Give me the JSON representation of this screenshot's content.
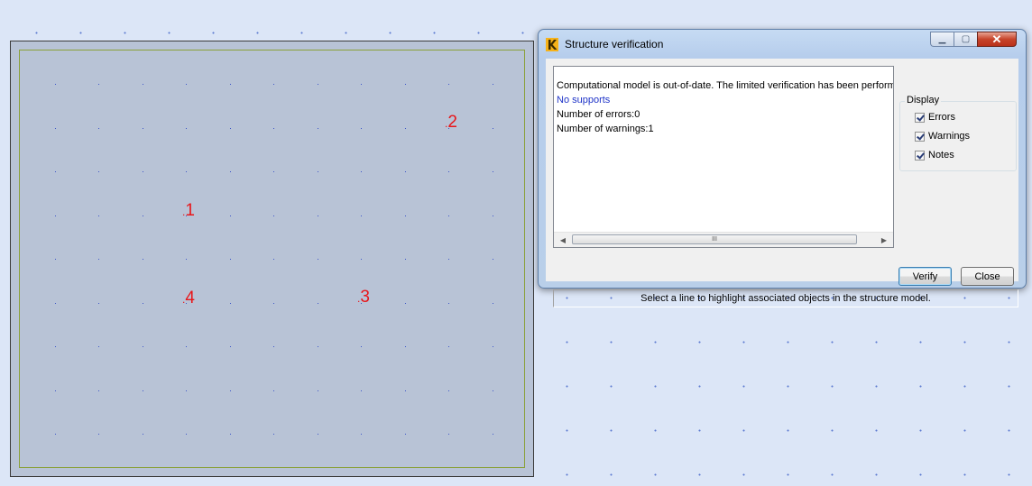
{
  "viewport": {
    "nodes": [
      {
        "id": "1",
        "label": "1"
      },
      {
        "id": "2",
        "label": "2"
      },
      {
        "id": "3",
        "label": "3"
      },
      {
        "id": "4",
        "label": "4"
      }
    ]
  },
  "dialog": {
    "title": "Structure verification",
    "icon": "app-logo-icon",
    "messages": [
      {
        "text": "Computational model is out-of-date. The limited verification has been perform",
        "kind": "info"
      },
      {
        "text": "No supports",
        "kind": "warning-link"
      },
      {
        "text": "Number of errors:0",
        "kind": "info"
      },
      {
        "text": "Number of warnings:1",
        "kind": "info"
      }
    ],
    "display": {
      "title": "Display",
      "options": [
        {
          "label": "Errors",
          "checked": true
        },
        {
          "label": "Warnings",
          "checked": true
        },
        {
          "label": "Notes",
          "checked": true
        }
      ]
    },
    "buttons": {
      "verify": "Verify",
      "close": "Close"
    },
    "scrollbar_grip": "III",
    "status": "Select a line to highlight associated objects in the structure model."
  },
  "colors": {
    "node_label": "#e8161a",
    "link_text": "#1f34c8",
    "viewport_bg": "#b8c3d6"
  }
}
